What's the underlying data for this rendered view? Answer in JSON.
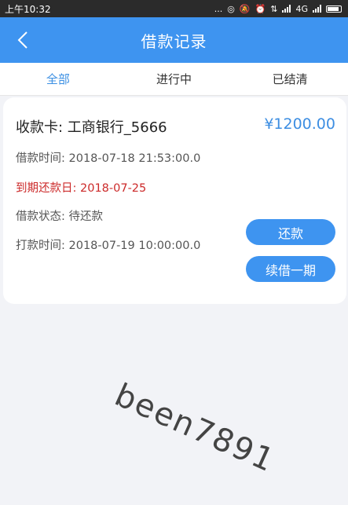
{
  "status_bar": {
    "time": "上午10:32",
    "dots": "...",
    "network": "4G"
  },
  "header": {
    "title": "借款记录"
  },
  "tabs": [
    {
      "label": "全部",
      "active": true
    },
    {
      "label": "进行中",
      "active": false
    },
    {
      "label": "已结清",
      "active": false
    }
  ],
  "loan": {
    "card_label": "收款卡: 工商银行_5666",
    "amount": "¥1200.00",
    "loan_time": "借款时间: 2018-07-18 21:53:00.0",
    "due_date": "到期还款日: 2018-07-25",
    "status": "借款状态: 待还款",
    "payout_time": "打款时间: 2018-07-19 10:00:00.0",
    "repay_button": "还款",
    "extend_button": "续借一期"
  },
  "watermark": "been7891",
  "colors": {
    "primary": "#3e94f0",
    "due_red": "#cc2a2a"
  }
}
